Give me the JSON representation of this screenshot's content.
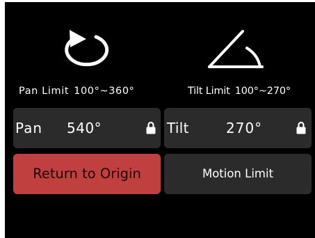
{
  "pan": {
    "icon": "rotate-ccw-icon",
    "caption_label": "Pan Limit",
    "caption_range": "100°~360°",
    "name": "Pan",
    "value": "540°",
    "lock_icon": "lock-icon"
  },
  "tilt": {
    "icon": "tilt-angle-icon",
    "caption_label": "Tilt Limit",
    "caption_range": "100°~270°",
    "name": "Tilt",
    "value": "270°",
    "lock_icon": "lock-icon"
  },
  "buttons": {
    "return_label": "Return to Origin",
    "motion_label": "Motion Limit"
  },
  "colors": {
    "background": "#000000",
    "panel": "#2b2b2b",
    "accent": "#c0403f",
    "text": "#ffffff"
  }
}
